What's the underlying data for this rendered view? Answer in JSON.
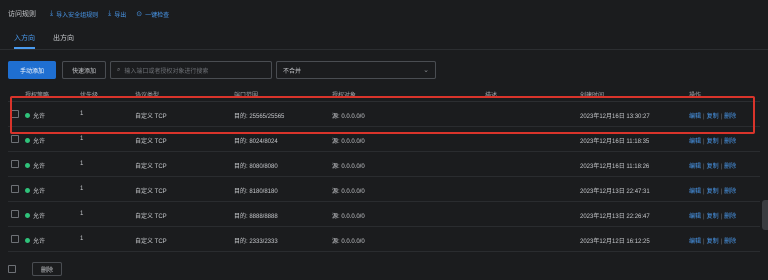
{
  "header": {
    "title": "访问规则",
    "actions": [
      {
        "label": "导入安全组规则",
        "icon": "import-icon"
      },
      {
        "label": "导出",
        "icon": "export-icon"
      },
      {
        "label": "一键检查",
        "icon": "check-icon"
      }
    ]
  },
  "tabs": [
    {
      "label": "入方向",
      "active": true
    },
    {
      "label": "出方向",
      "active": false
    }
  ],
  "toolbar": {
    "add_label": "手动添加",
    "quick_add_label": "快速添加",
    "search_placeholder": "输入端口或者授权对象进行搜索",
    "filter_value": "不合并"
  },
  "table": {
    "headers": [
      "授权策略",
      "优先级",
      "协议类型",
      "端口范围",
      "授权对象",
      "描述",
      "创建时间",
      "操作"
    ],
    "rows": [
      {
        "policy": "允许",
        "priority": "1",
        "protocol": "自定义 TCP",
        "port": "目的: 25565/25565",
        "object": "源: 0.0.0.0/0",
        "desc": "",
        "created": "2023年12月16日 13:30:27",
        "highlighted": true
      },
      {
        "policy": "允许",
        "priority": "1",
        "protocol": "自定义 TCP",
        "port": "目的: 8024/8024",
        "object": "源: 0.0.0.0/0",
        "desc": "",
        "created": "2023年12月16日 11:18:35",
        "highlighted": false
      },
      {
        "policy": "允许",
        "priority": "1",
        "protocol": "自定义 TCP",
        "port": "目的: 8080/8080",
        "object": "源: 0.0.0.0/0",
        "desc": "",
        "created": "2023年12月16日 11:18:26",
        "highlighted": false
      },
      {
        "policy": "允许",
        "priority": "1",
        "protocol": "自定义 TCP",
        "port": "目的: 8180/8180",
        "object": "源: 0.0.0.0/0",
        "desc": "",
        "created": "2023年12月13日 22:47:31",
        "highlighted": false
      },
      {
        "policy": "允许",
        "priority": "1",
        "protocol": "自定义 TCP",
        "port": "目的: 8888/8888",
        "object": "源: 0.0.0.0/0",
        "desc": "",
        "created": "2023年12月13日 22:26:47",
        "highlighted": false
      },
      {
        "policy": "允许",
        "priority": "1",
        "protocol": "自定义 TCP",
        "port": "目的: 2333/2333",
        "object": "源: 0.0.0.0/0",
        "desc": "",
        "created": "2023年12月12日 16:12:25",
        "highlighted": false
      }
    ],
    "ops": {
      "edit": "编辑",
      "copy": "复制",
      "delete": "删除",
      "sep": "|"
    }
  },
  "footer": {
    "delete_label": "删除"
  },
  "colors": {
    "accent": "#1f6fd1",
    "link": "#4a9bf0",
    "allow": "#2fc27a",
    "highlight": "#d9342b"
  }
}
